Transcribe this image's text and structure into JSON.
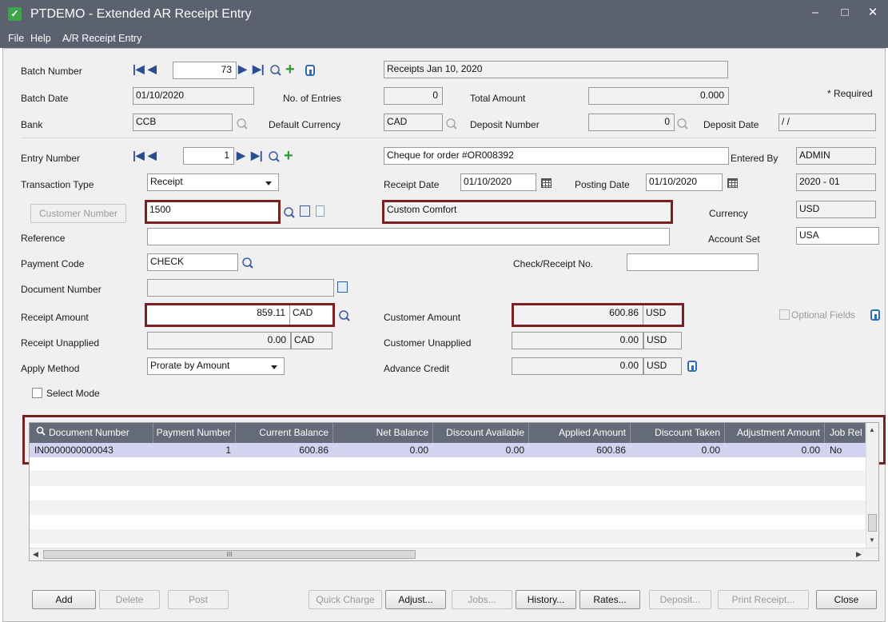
{
  "window": {
    "title": "PTDEMO - Extended AR Receipt Entry",
    "minimize": "–",
    "maximize": "□",
    "close": "✕"
  },
  "menu": [
    "File",
    "Help",
    "A/R Receipt Entry"
  ],
  "batch": {
    "number_label": "Batch Number",
    "number_value": "73",
    "description": "Receipts Jan 10, 2020",
    "date_label": "Batch Date",
    "date_value": "01/10/2020",
    "entries_label": "No. of Entries",
    "entries_value": "0",
    "total_label": "Total Amount",
    "total_value": "0.000",
    "required": "* Required",
    "bank_label": "Bank",
    "bank_value": "CCB",
    "currency_label": "Default Currency",
    "currency_value": "CAD",
    "deposit_no_label": "Deposit Number",
    "deposit_no_value": "0",
    "deposit_date_label": "Deposit Date",
    "deposit_date_value": "/ /"
  },
  "entry": {
    "number_label": "Entry Number",
    "number_value": "1",
    "description": "Cheque for order #OR008392",
    "entered_by_label": "Entered By",
    "entered_by_value": "ADMIN",
    "type_label": "Transaction Type",
    "type_value": "Receipt",
    "receipt_date_label": "Receipt Date",
    "receipt_date_value": "01/10/2020",
    "posting_date_label": "Posting Date",
    "posting_date_value": "01/10/2020",
    "period_value": "2020 - 01",
    "customer_btn": "Customer Number",
    "customer_value": "1500",
    "customer_name": "Custom Comfort",
    "currency_label": "Currency",
    "currency_value": "USD",
    "reference_label": "Reference",
    "reference_value": "",
    "account_set_label": "Account Set",
    "account_set_value": "USA",
    "payment_code_label": "Payment Code",
    "payment_code_value": "CHECK",
    "check_no_label": "Check/Receipt No.",
    "check_no_value": "",
    "doc_number_label": "Document Number",
    "doc_number_value": "",
    "receipt_amount_label": "Receipt Amount",
    "receipt_amount_value": "859.11",
    "receipt_currency": "CAD",
    "customer_amount_label": "Customer Amount",
    "customer_amount_value": "600.86",
    "customer_amount_currency": "USD",
    "optional_fields": "Optional Fields",
    "unapplied_label": "Receipt Unapplied",
    "unapplied_value": "0.00",
    "unapplied_currency": "CAD",
    "cust_unapplied_label": "Customer Unapplied",
    "cust_unapplied_value": "0.00",
    "cust_unapplied_currency": "USD",
    "apply_method_label": "Apply Method",
    "apply_method_value": "Prorate by Amount",
    "advance_credit_label": "Advance Credit",
    "advance_credit_value": "0.00",
    "advance_credit_currency": "USD",
    "select_mode": "Select Mode"
  },
  "grid": {
    "columns": [
      "Document Number",
      "Payment Number",
      "Current Balance",
      "Net Balance",
      "Discount Available",
      "Applied Amount",
      "Discount Taken",
      "Adjustment Amount",
      "Job Rel"
    ],
    "rows": [
      [
        "IN0000000000043",
        "1",
        "600.86",
        "0.00",
        "0.00",
        "600.86",
        "0.00",
        "0.00",
        "No"
      ]
    ],
    "scroll_mid": "III"
  },
  "buttons": {
    "add": "Add",
    "delete": "Delete",
    "post": "Post",
    "quick_charge": "Quick Charge",
    "adjust": "Adjust...",
    "jobs": "Jobs...",
    "history": "History...",
    "rates": "Rates...",
    "deposit": "Deposit...",
    "print_receipt": "Print Receipt...",
    "close": "Close"
  },
  "colors": {
    "titlebar": "#5c6170",
    "highlight": "#7a1f22",
    "grid_header": "#646a78",
    "selected_row": "#d3d3f1",
    "accent_blue": "#2f6db7",
    "add_green": "#2e9a37"
  }
}
